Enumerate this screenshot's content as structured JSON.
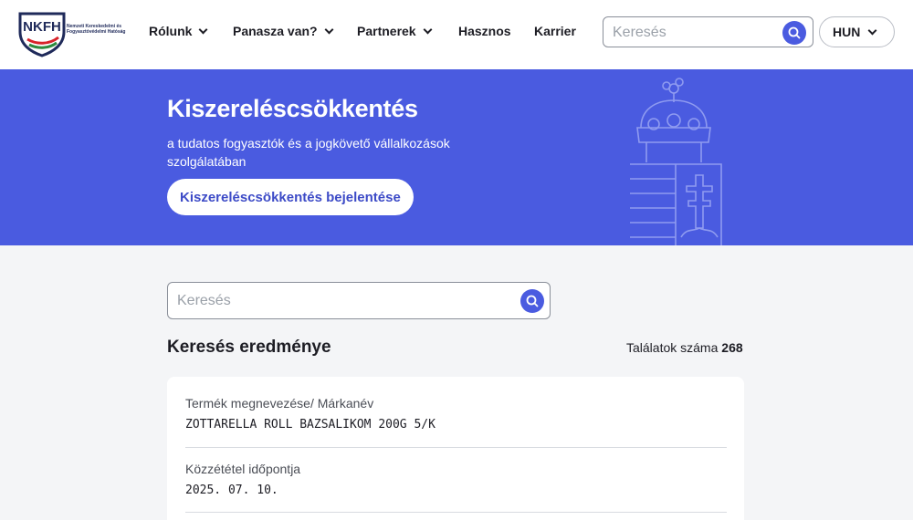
{
  "header": {
    "logo_text": "NKFH",
    "logo_subtitle": "Nemzeti Kereskedelmi és Fogyasztóvédelmi Hatóság",
    "nav": [
      {
        "label": "Rólunk",
        "has_dropdown": true
      },
      {
        "label": "Panasza van?",
        "has_dropdown": true
      },
      {
        "label": "Partnerek",
        "has_dropdown": true
      },
      {
        "label": "Hasznos",
        "has_dropdown": false
      },
      {
        "label": "Karrier",
        "has_dropdown": false
      }
    ],
    "search_placeholder": "Keresés",
    "language": "HUN"
  },
  "hero": {
    "title": "Kiszereléscsökkentés",
    "subtitle": "a tudatos fogyasztók és a jogkövető vállalkozások szolgálatában",
    "button_label": "Kiszereléscsökkentés bejelentése"
  },
  "search": {
    "placeholder": "Keresés"
  },
  "results": {
    "title": "Keresés eredménye",
    "count_label": "Találatok száma",
    "count": "268",
    "items": [
      {
        "product_label": "Termék megnevezése/ Márkanév",
        "product_value": "ZOTTARELLA ROLL BAZSALIKOM 200G 5/K",
        "date_label": "Közzététel időpontja",
        "date_value": "2025. 07. 10."
      }
    ]
  },
  "colors": {
    "brand_blue": "#4a5be0",
    "button_text": "#3d4bc7",
    "background": "#f4f5f7",
    "flag_red": "#d8232a",
    "flag_green": "#2e8b3e"
  },
  "icons": [
    "search-icon",
    "chevron-down-icon",
    "coat-of-arms-icon",
    "logo-shield-icon"
  ]
}
